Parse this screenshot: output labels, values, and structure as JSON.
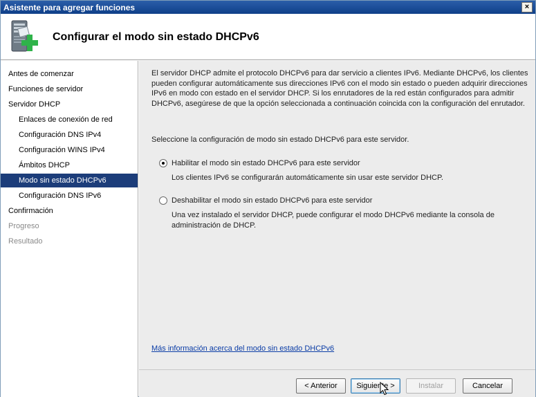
{
  "window": {
    "title": "Asistente para agregar funciones",
    "close_label": "×"
  },
  "header": {
    "title": "Configurar el modo sin estado DHCPv6",
    "icon": "server-add-icon"
  },
  "sidebar": {
    "items": [
      {
        "label": "Antes de comenzar"
      },
      {
        "label": "Funciones de servidor"
      },
      {
        "label": "Servidor DHCP"
      },
      {
        "label": "Enlaces de conexión de red"
      },
      {
        "label": "Configuración DNS IPv4"
      },
      {
        "label": "Configuración WINS IPv4"
      },
      {
        "label": "Ámbitos DHCP"
      },
      {
        "label": "Modo sin estado DHCPv6"
      },
      {
        "label": "Configuración DNS IPv6"
      },
      {
        "label": "Confirmación"
      },
      {
        "label": "Progreso"
      },
      {
        "label": "Resultado"
      }
    ]
  },
  "main": {
    "intro": "El servidor DHCP admite el protocolo DHCPv6 para dar servicio a clientes IPv6. Mediante DHCPv6, los clientes pueden configurar automáticamente sus direcciones IPv6 con el modo sin estado o pueden adquirir direcciones IPv6 en modo con estado en el servidor DHCP. Si los enrutadores de la red están configurados para admitir DHCPv6, asegúrese de que la opción seleccionada a continuación coincida con la configuración del enrutador.",
    "prompt": "Seleccione la configuración de modo sin estado DHCPv6 para este servidor.",
    "options": [
      {
        "label": "Habilitar el modo sin estado DHCPv6 para este servidor",
        "description": "Los clientes IPv6 se configurarán automáticamente sin usar este servidor DHCP.",
        "selected": true
      },
      {
        "label": "Deshabilitar el modo sin estado DHCPv6 para este servidor",
        "description": "Una vez instalado el servidor DHCP, puede configurar el modo DHCPv6 mediante la consola de administración de DHCP.",
        "selected": false
      }
    ],
    "more_info_link": "Más información acerca del modo sin estado DHCPv6"
  },
  "footer": {
    "back_label": "< Anterior",
    "next_label": "Siguiente >",
    "install_label": "Instalar",
    "cancel_label": "Cancelar"
  },
  "colors": {
    "selected_nav": "#1c3d7a",
    "titlebar": "#1d4f9a",
    "link": "#0a3ca6"
  }
}
